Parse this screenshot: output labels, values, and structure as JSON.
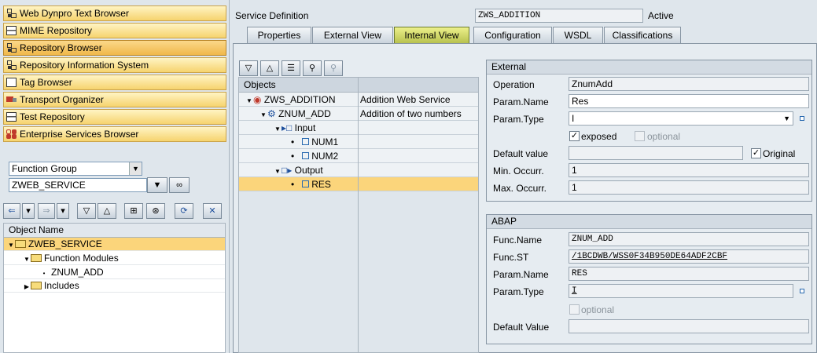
{
  "nav": {
    "buttons": [
      {
        "label": "Web Dynpro Text Browser",
        "icon": "tree-icon"
      },
      {
        "label": "MIME Repository",
        "icon": "mime-icon"
      },
      {
        "label": "Repository Browser",
        "icon": "tree-icon"
      },
      {
        "label": "Repository Information System",
        "icon": "info-system-icon"
      },
      {
        "label": "Tag Browser",
        "icon": "tag-icon"
      },
      {
        "label": "Transport Organizer",
        "icon": "truck-icon"
      },
      {
        "label": "Test Repository",
        "icon": "test-icon"
      },
      {
        "label": "Enterprise Services Browser",
        "icon": "enterprise-services-icon"
      }
    ],
    "object_type": "Function Group",
    "object_name": "ZWEB_SERVICE",
    "tree": {
      "header": "Object Name",
      "rows": [
        "ZWEB_SERVICE",
        "Function Modules",
        "ZNUM_ADD",
        "Includes"
      ]
    }
  },
  "header": {
    "service_definition_label": "Service Definition",
    "service_definition_value": "ZWS_ADDITION",
    "status": "Active"
  },
  "tabs": [
    "Properties",
    "External View",
    "Internal View",
    "Configuration",
    "WSDL",
    "Classifications"
  ],
  "active_tab": "Internal View",
  "service_tree": {
    "col_objects": "Objects",
    "col_desc": "",
    "rows": [
      {
        "name": "ZWS_ADDITION",
        "desc": "Addition Web Service"
      },
      {
        "name": "ZNUM_ADD",
        "desc": "Addition of  two numbers"
      },
      {
        "name": "Input",
        "desc": ""
      },
      {
        "name": "NUM1",
        "desc": ""
      },
      {
        "name": "NUM2",
        "desc": ""
      },
      {
        "name": "Output",
        "desc": ""
      },
      {
        "name": "RES",
        "desc": ""
      }
    ]
  },
  "external": {
    "title": "External",
    "operation_label": "Operation",
    "operation_value": "ZnumAdd",
    "param_name_label": "Param.Name",
    "param_name_value": "Res",
    "param_type_label": "Param.Type",
    "param_type_value": "I",
    "exposed_label": "exposed",
    "optional_label": "optional",
    "default_value_label": "Default value",
    "default_value": "",
    "original_label": "Original",
    "min_occurr_label": "Min. Occurr.",
    "min_occurr_value": "1",
    "max_occurr_label": "Max. Occurr.",
    "max_occurr_value": "1"
  },
  "abap": {
    "title": "ABAP",
    "func_name_label": "Func.Name",
    "func_name_value": "ZNUM_ADD",
    "func_st_label": "Func.ST",
    "func_st_value": "/1BCDWB/WSS0F34B950DE64ADF2CBF",
    "param_name_label": "Param.Name",
    "param_name_value": "RES",
    "param_type_label": "Param.Type",
    "param_type_value": "I",
    "optional_label": "optional",
    "default_value_label": "Default Value",
    "default_value": ""
  }
}
